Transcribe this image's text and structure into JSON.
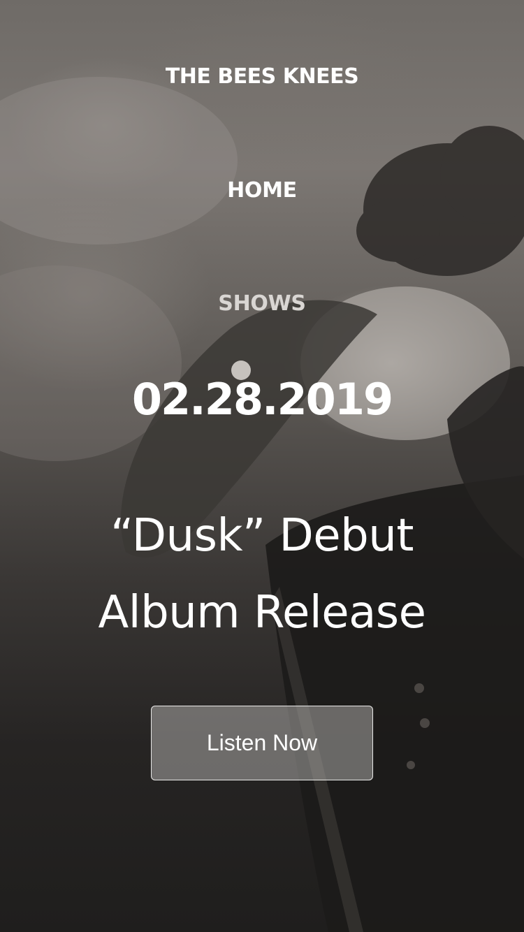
{
  "header": {
    "brand": "THE BEES KNEES"
  },
  "nav": {
    "items": [
      {
        "label": "HOME"
      },
      {
        "label": "SHOWS"
      }
    ]
  },
  "hero": {
    "date": "02.28.2019",
    "title_line1": "“Dusk” Debut",
    "title_line2": "Album Release",
    "cta_label": "Listen Now",
    "image": "concert-guitarist-photo"
  },
  "colors": {
    "text": "#ffffff",
    "nav_secondary": "#d9d6d3",
    "button_fill": "#a8a6a4",
    "background_dark": "#1f1e1d"
  }
}
